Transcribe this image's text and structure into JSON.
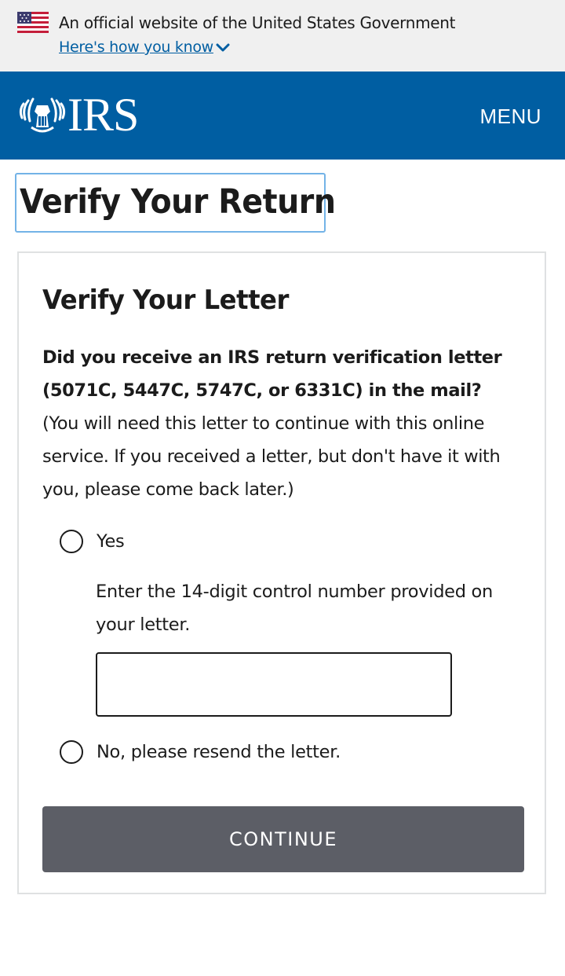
{
  "gov_banner": {
    "text": "An official website of the United States Government",
    "link": "Here's how you know",
    "flag_icon": "us-flag-icon",
    "chevron_icon": "chevron-down-icon"
  },
  "header": {
    "logo_text": "IRS",
    "logo_icon": "irs-eagle-icon",
    "menu_label": "MENU",
    "background_color": "#005ea2"
  },
  "page": {
    "title": "Verify Your Return"
  },
  "card": {
    "title": "Verify Your Letter",
    "question": "Did you receive an IRS return verification letter (5071C, 5447C, 5747C, or 6331C) in the mail?",
    "note": "(You will need this letter to continue with this online service. If you received a letter, but don't have it with you, please come back later.)",
    "options": [
      {
        "label": "Yes",
        "selected": false
      },
      {
        "label": "No, please resend the letter.",
        "selected": false
      }
    ],
    "control_number_help": "Enter the 14-digit control number provided on your letter.",
    "control_number_value": "",
    "continue_label": "CONTINUE",
    "continue_color": "#5c5e66"
  }
}
